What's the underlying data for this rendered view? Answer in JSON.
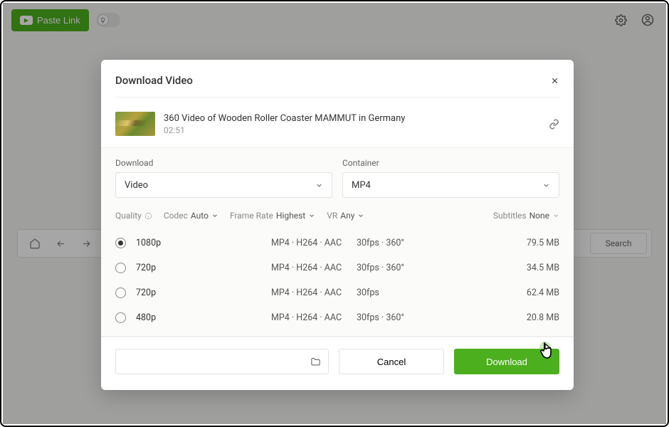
{
  "topbar": {
    "paste_label": "Paste Link"
  },
  "nav": {
    "search_label": "Search"
  },
  "dialog": {
    "title": "Download Video",
    "video": {
      "title": "360 Video of Wooden Roller Coaster MAMMUT in Germany",
      "duration": "02:51"
    },
    "selects": {
      "download": {
        "label": "Download",
        "value": "Video"
      },
      "container": {
        "label": "Container",
        "value": "MP4"
      }
    },
    "filters": {
      "quality_label": "Quality",
      "codec_label": "Codec",
      "codec_value": "Auto",
      "framerate_label": "Frame Rate",
      "framerate_value": "Highest",
      "vr_label": "VR",
      "vr_value": "Any",
      "subtitles_label": "Subtitles",
      "subtitles_value": "None"
    },
    "options": [
      {
        "quality": "1080p",
        "codec": "MP4 · H264 · AAC",
        "fps": "30fps · 360°",
        "size": "79.5 MB",
        "selected": true
      },
      {
        "quality": "720p",
        "codec": "MP4 · H264 · AAC",
        "fps": "30fps · 360°",
        "size": "34.5 MB",
        "selected": false
      },
      {
        "quality": "720p",
        "codec": "MP4 · H264 · AAC",
        "fps": "30fps",
        "size": "62.4 MB",
        "selected": false
      },
      {
        "quality": "480p",
        "codec": "MP4 · H264 · AAC",
        "fps": "30fps · 360°",
        "size": "20.8 MB",
        "selected": false
      }
    ],
    "footer": {
      "cancel": "Cancel",
      "download": "Download"
    }
  }
}
